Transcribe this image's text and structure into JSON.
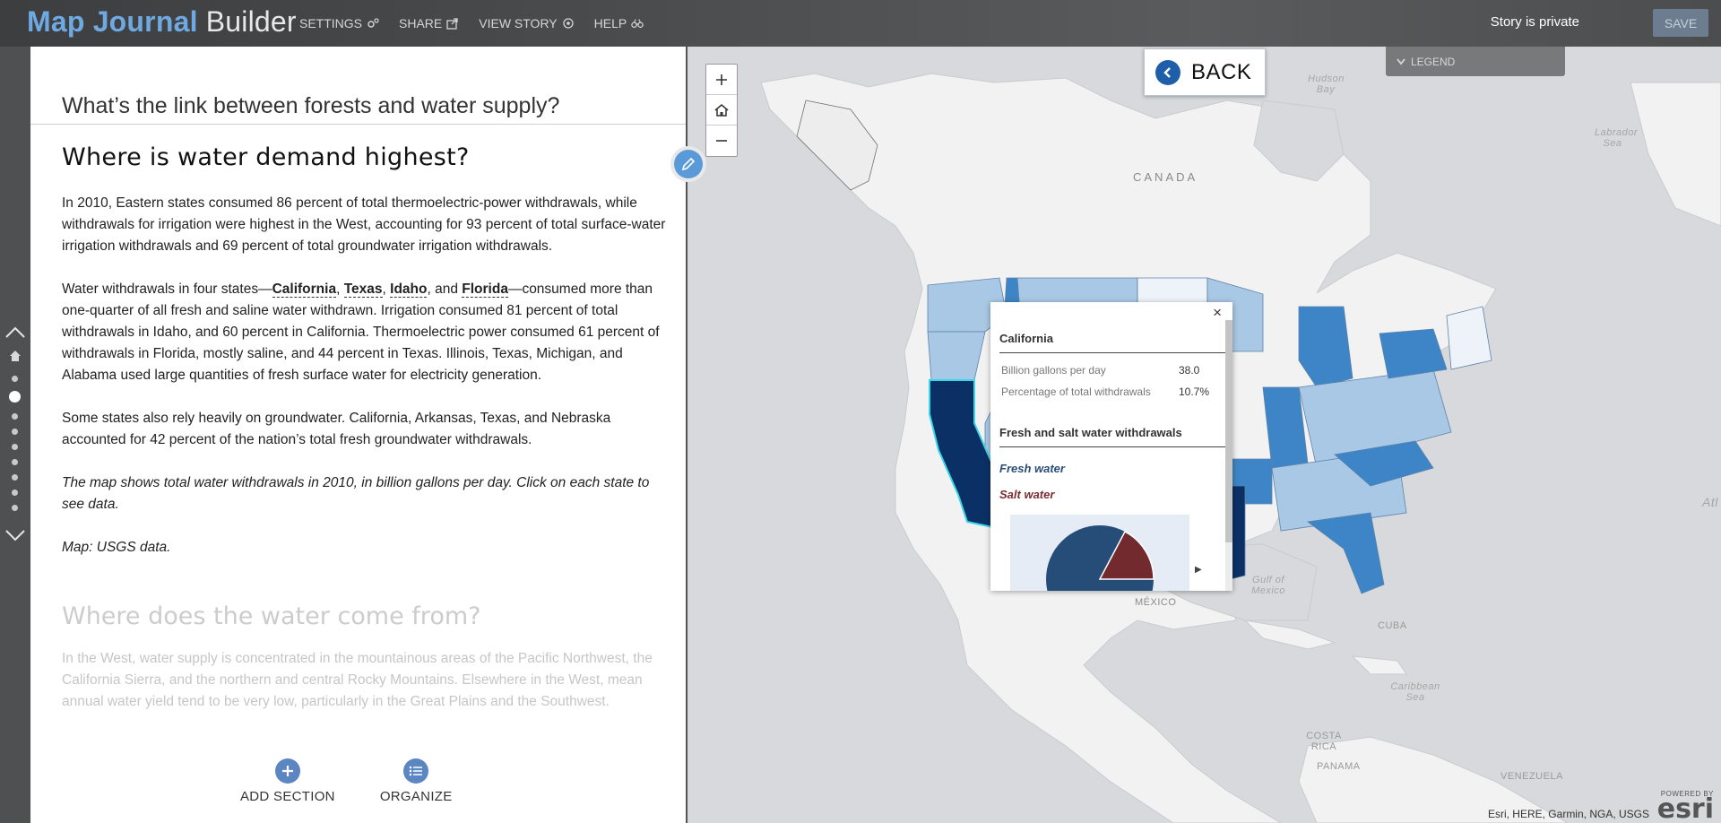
{
  "app": {
    "title_part1": "Map Journal",
    "title_part2": "Builder",
    "menu": [
      {
        "label": "SETTINGS",
        "icon": "gears-icon"
      },
      {
        "label": "SHARE",
        "icon": "share-icon"
      },
      {
        "label": "VIEW STORY",
        "icon": "eye-icon"
      },
      {
        "label": "HELP",
        "icon": "binoculars-icon"
      }
    ],
    "privacy": "Story is private",
    "save_label": "SAVE"
  },
  "panel": {
    "story_title": "What’s the link between forests and water supply?",
    "section1_title": "Where is water demand highest?",
    "p1": "In 2010, Eastern states consumed 86 percent of total thermoelectric-power withdrawals, while withdrawals for irrigation were highest in the West, accounting for 93 percent of total surface-water irrigation withdrawals and 69 percent of total groundwater irrigation withdrawals.",
    "p2_prefix": "Water withdrawals in four states—",
    "p2_links": [
      "California",
      "Texas",
      "Idaho",
      "Florida"
    ],
    "p2_sep1": ", ",
    "p2_sep2": ", ",
    "p2_sep3": ", and ",
    "p2_suffix": "—consumed more than one-quarter of all fresh and saline water withdrawn. Irrigation consumed 81 percent of total withdrawals in Idaho, and 60 percent in California. Thermoelectric power consumed 61 percent of withdrawals in Florida, mostly saline, and 44 percent in Texas. Illinois, Texas, Michigan, and Alabama used large quantities of fresh surface water for electricity generation.",
    "p3": "Some states also rely heavily on groundwater. California, Arkansas, Texas, and Nebraska accounted for 42 percent of the nation’s total fresh groundwater withdrawals.",
    "p4": "The map shows total water withdrawals in 2010, in billion gallons per day. Click on each state to see data.",
    "p5": "Map: USGS data.",
    "section2_title": "Where does the water come from?",
    "section2_text": "In the West, water supply is concentrated in the mountainous areas of the Pacific Northwest, the California Sierra, and the northern and central Rocky Mountains. Elsewhere in the West, mean annual water yield tend to be very low, particularly in the Great Plains and the Southwest.",
    "add_section_label": "ADD SECTION",
    "organize_label": "ORGANIZE"
  },
  "nav": {
    "section_count": 9,
    "active_index": 1
  },
  "map": {
    "back_label": "BACK",
    "legend_label": "LEGEND",
    "labels": {
      "canada": "CANADA",
      "mexico": "MÉXICO",
      "cuba": "CUBA",
      "hudson_bay": "Hudson Bay",
      "labrador_sea": "Labrador Sea",
      "gulf_of_mexico": "Gulf of Mexico",
      "caribbean_sea": "Caribbean Sea",
      "costa_rica": "COSTA RICA",
      "panama": "PANAMA",
      "venezuela": "VENEZUELA",
      "atl": "Atl"
    },
    "attribution": "Esri, HERE, Garmin, NGA, USGS",
    "esri_powered": "POWERED BY",
    "esri_logo": "esri",
    "colors": {
      "light": "#a9c8e5",
      "lightest": "#eef3fa",
      "medium": "#3d85c6",
      "dark": "#0b3066",
      "selected_outline": "#3ad6e6"
    }
  },
  "popup": {
    "title": "California",
    "rows": [
      {
        "label": "Billion gallons per day",
        "value": "38.0"
      },
      {
        "label": "Percentage of total withdrawals",
        "value": "10.7%"
      }
    ],
    "chart_title": "Fresh and salt water withdrawals",
    "fresh_label": "Fresh water",
    "salt_label": "Salt water",
    "fresh_color": "#264d78",
    "salt_color": "#722a2e"
  }
}
